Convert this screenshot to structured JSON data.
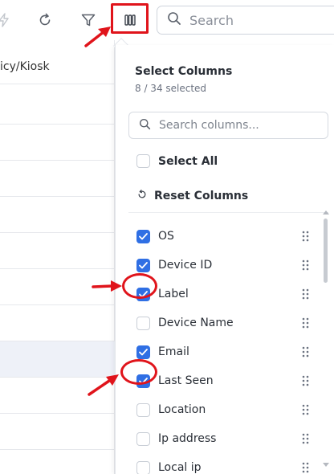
{
  "toolbar": {
    "search_placeholder": "Search",
    "icons": [
      "lightning-icon",
      "refresh-icon",
      "filter-icon",
      "columns-icon",
      "search-icon"
    ]
  },
  "table": {
    "header_text": "icy/Kiosk"
  },
  "panel": {
    "title": "Select Columns",
    "selected_count": "8 / 34 selected",
    "search_placeholder": "Search columns...",
    "select_all_label": "Select All",
    "reset_label": "Reset Columns",
    "columns": [
      {
        "label": "OS",
        "checked": true
      },
      {
        "label": "Device ID",
        "checked": true
      },
      {
        "label": "Label",
        "checked": true
      },
      {
        "label": "Device Name",
        "checked": false
      },
      {
        "label": "Email",
        "checked": true
      },
      {
        "label": "Last Seen",
        "checked": true
      },
      {
        "label": "Location",
        "checked": false
      },
      {
        "label": "Ip address",
        "checked": false
      },
      {
        "label": "Local ip",
        "checked": false
      }
    ]
  },
  "colors": {
    "accent": "#2f6fe4",
    "annotation": "#e0141b"
  }
}
